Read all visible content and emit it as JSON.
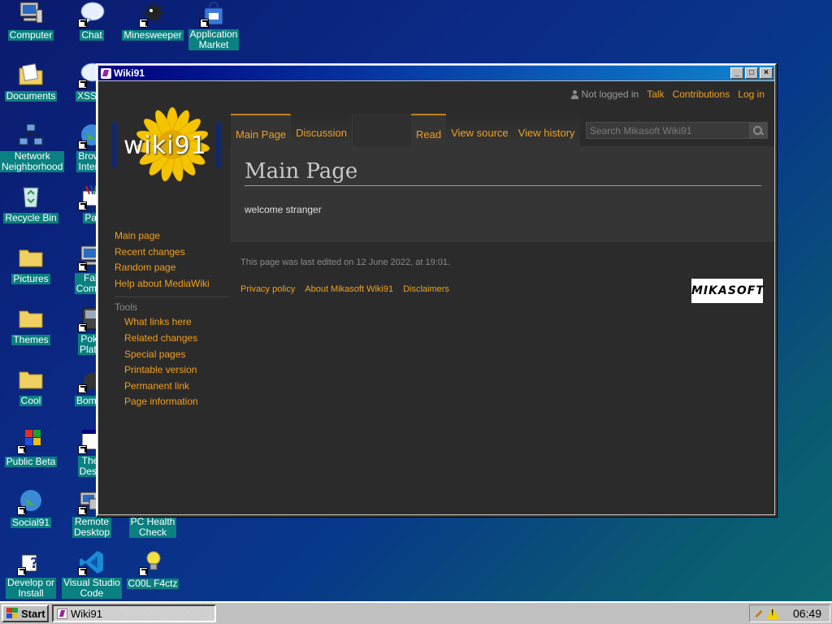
{
  "desktop": {
    "icons": [
      {
        "label": "Computer"
      },
      {
        "label": "Chat"
      },
      {
        "label": "Minesweeper"
      },
      {
        "label": "Application\nMarket"
      },
      {
        "label": "Documents"
      },
      {
        "label": "XSS C"
      },
      {
        "label": "Network\nNeighborhood"
      },
      {
        "label": "Brows\nInterw"
      },
      {
        "label": "Recycle Bin"
      },
      {
        "label": "Pai"
      },
      {
        "label": "Pictures"
      },
      {
        "label": "Fak\nCompu"
      },
      {
        "label": "Themes"
      },
      {
        "label": "Poké\nPlatin"
      },
      {
        "label": "Cool"
      },
      {
        "label": "Bombe"
      },
      {
        "label": "Public Beta"
      },
      {
        "label": "Ther\nDesig"
      },
      {
        "label": "Social91"
      },
      {
        "label": "Remote\nDesktop"
      },
      {
        "label": "PC Health\nCheck"
      },
      {
        "label": "Develop or\nInstall"
      },
      {
        "label": "Visual Studio\nCode"
      },
      {
        "label": "C00L F4ctz"
      }
    ]
  },
  "window": {
    "title": "Wiki91",
    "buttons": {
      "minimize": "_",
      "maximize": "□",
      "close": "×"
    }
  },
  "wiki": {
    "personal": {
      "not_logged_in": "Not logged in",
      "talk": "Talk",
      "contributions": "Contributions",
      "login": "Log in"
    },
    "logo_text": "wiki91",
    "nav": {
      "main": [
        "Main page",
        "Recent changes",
        "Random page",
        "Help about MediaWiki"
      ],
      "tools_heading": "Tools",
      "tools": [
        "What links here",
        "Related changes",
        "Special pages",
        "Printable version",
        "Permanent link",
        "Page information"
      ]
    },
    "tabs": {
      "left": [
        "Main Page",
        "Discussion"
      ],
      "right": [
        "Read",
        "View source",
        "View history"
      ]
    },
    "search": {
      "placeholder": "Search Mikasoft Wiki91"
    },
    "article": {
      "title": "Main Page",
      "body": "welcome stranger"
    },
    "footer": {
      "last_edited": "This page was last edited on 12 June 2022, at 19:01.",
      "links": [
        "Privacy policy",
        "About Mikasoft Wiki91",
        "Disclaimers"
      ],
      "badge": "MIKASOFT"
    }
  },
  "taskbar": {
    "start": "Start",
    "task": "Wiki91",
    "clock": "06:49"
  },
  "colors": {
    "accent_link": "#f0a020",
    "title_bar": "#000080",
    "icon_label_bg": "#0a8080",
    "wiki_bg": "#2b2b2b"
  }
}
